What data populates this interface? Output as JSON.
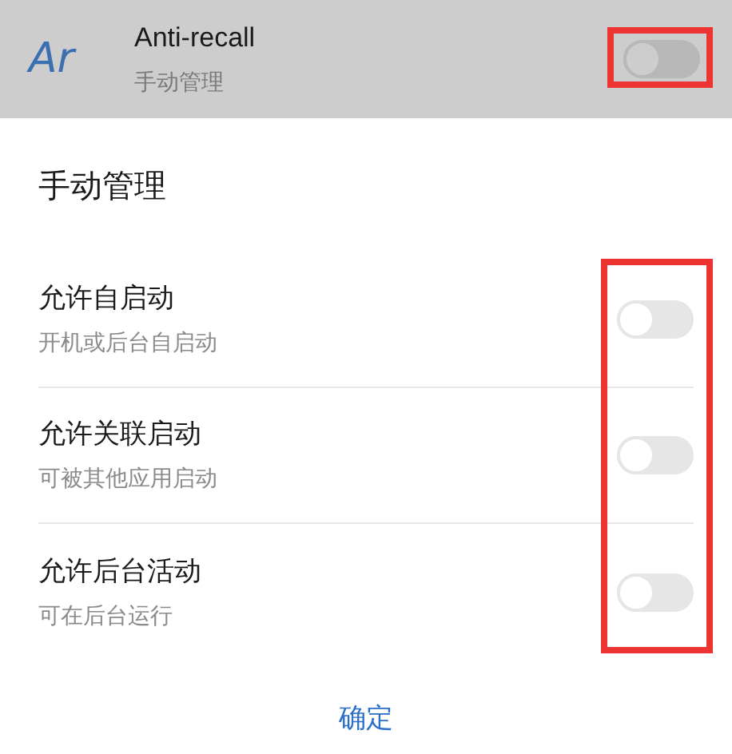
{
  "app_row": {
    "icon_text": "Ar",
    "title": "Anti-recall",
    "subtitle": "手动管理",
    "on": false,
    "highlighted": true
  },
  "dialog": {
    "title": "手动管理",
    "toggles_highlighted": true,
    "options": [
      {
        "title": "允许自启动",
        "subtitle": "开机或后台自启动",
        "on": false
      },
      {
        "title": "允许关联启动",
        "subtitle": "可被其他应用启动",
        "on": false
      },
      {
        "title": "允许后台活动",
        "subtitle": "可在后台运行",
        "on": false
      }
    ],
    "confirm": "确定"
  }
}
